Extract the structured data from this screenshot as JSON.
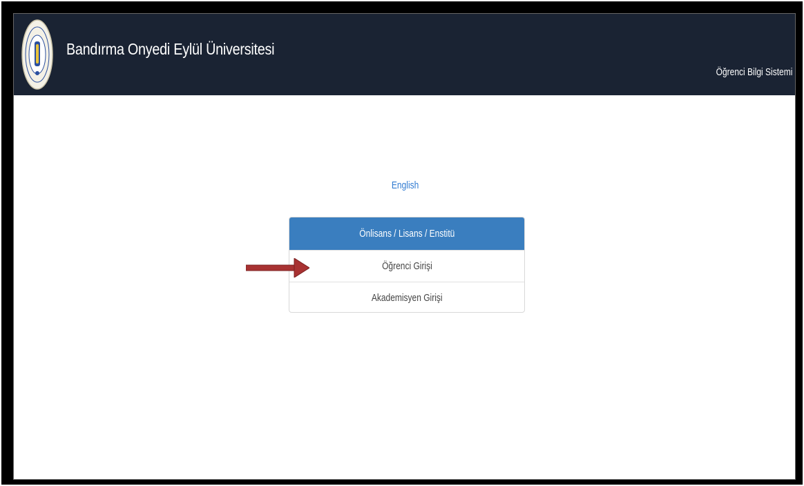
{
  "header": {
    "university_name": "Bandırma Onyedi Eylül Üniversitesi",
    "system_name": "Öğrenci Bilgi Sistemi",
    "logo_icon": "university-seal-icon",
    "background_color": "#1a2333"
  },
  "language_link": {
    "label": "English",
    "color": "#2f7ad1"
  },
  "login_panel": {
    "heading": "Önlisans / Lisans / Enstitü",
    "heading_color": "#3a7ebf",
    "items": [
      {
        "label": "Öğrenci Girişi"
      },
      {
        "label": "Akademisyen Girişi"
      }
    ]
  },
  "annotation": {
    "icon": "red-arrow-icon",
    "color": "#a83232"
  }
}
